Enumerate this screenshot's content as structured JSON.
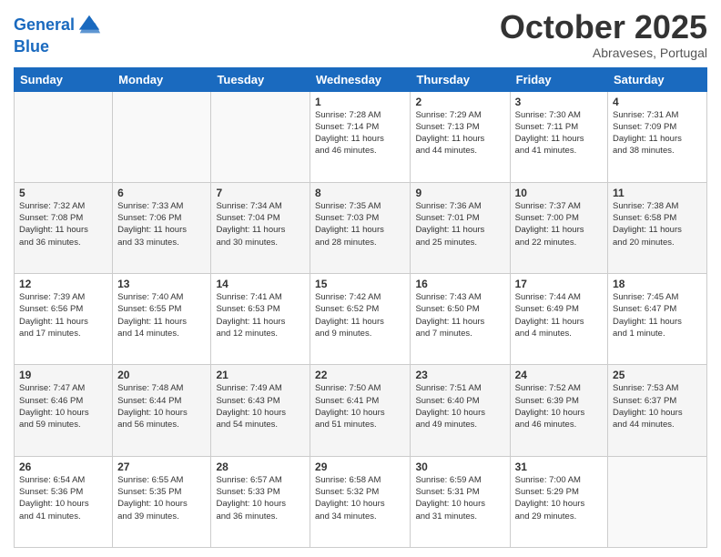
{
  "header": {
    "logo_line1": "General",
    "logo_line2": "Blue",
    "month": "October 2025",
    "location": "Abraveses, Portugal"
  },
  "days_of_week": [
    "Sunday",
    "Monday",
    "Tuesday",
    "Wednesday",
    "Thursday",
    "Friday",
    "Saturday"
  ],
  "weeks": [
    [
      {
        "day": "",
        "info": ""
      },
      {
        "day": "",
        "info": ""
      },
      {
        "day": "",
        "info": ""
      },
      {
        "day": "1",
        "info": "Sunrise: 7:28 AM\nSunset: 7:14 PM\nDaylight: 11 hours\nand 46 minutes."
      },
      {
        "day": "2",
        "info": "Sunrise: 7:29 AM\nSunset: 7:13 PM\nDaylight: 11 hours\nand 44 minutes."
      },
      {
        "day": "3",
        "info": "Sunrise: 7:30 AM\nSunset: 7:11 PM\nDaylight: 11 hours\nand 41 minutes."
      },
      {
        "day": "4",
        "info": "Sunrise: 7:31 AM\nSunset: 7:09 PM\nDaylight: 11 hours\nand 38 minutes."
      }
    ],
    [
      {
        "day": "5",
        "info": "Sunrise: 7:32 AM\nSunset: 7:08 PM\nDaylight: 11 hours\nand 36 minutes."
      },
      {
        "day": "6",
        "info": "Sunrise: 7:33 AM\nSunset: 7:06 PM\nDaylight: 11 hours\nand 33 minutes."
      },
      {
        "day": "7",
        "info": "Sunrise: 7:34 AM\nSunset: 7:04 PM\nDaylight: 11 hours\nand 30 minutes."
      },
      {
        "day": "8",
        "info": "Sunrise: 7:35 AM\nSunset: 7:03 PM\nDaylight: 11 hours\nand 28 minutes."
      },
      {
        "day": "9",
        "info": "Sunrise: 7:36 AM\nSunset: 7:01 PM\nDaylight: 11 hours\nand 25 minutes."
      },
      {
        "day": "10",
        "info": "Sunrise: 7:37 AM\nSunset: 7:00 PM\nDaylight: 11 hours\nand 22 minutes."
      },
      {
        "day": "11",
        "info": "Sunrise: 7:38 AM\nSunset: 6:58 PM\nDaylight: 11 hours\nand 20 minutes."
      }
    ],
    [
      {
        "day": "12",
        "info": "Sunrise: 7:39 AM\nSunset: 6:56 PM\nDaylight: 11 hours\nand 17 minutes."
      },
      {
        "day": "13",
        "info": "Sunrise: 7:40 AM\nSunset: 6:55 PM\nDaylight: 11 hours\nand 14 minutes."
      },
      {
        "day": "14",
        "info": "Sunrise: 7:41 AM\nSunset: 6:53 PM\nDaylight: 11 hours\nand 12 minutes."
      },
      {
        "day": "15",
        "info": "Sunrise: 7:42 AM\nSunset: 6:52 PM\nDaylight: 11 hours\nand 9 minutes."
      },
      {
        "day": "16",
        "info": "Sunrise: 7:43 AM\nSunset: 6:50 PM\nDaylight: 11 hours\nand 7 minutes."
      },
      {
        "day": "17",
        "info": "Sunrise: 7:44 AM\nSunset: 6:49 PM\nDaylight: 11 hours\nand 4 minutes."
      },
      {
        "day": "18",
        "info": "Sunrise: 7:45 AM\nSunset: 6:47 PM\nDaylight: 11 hours\nand 1 minute."
      }
    ],
    [
      {
        "day": "19",
        "info": "Sunrise: 7:47 AM\nSunset: 6:46 PM\nDaylight: 10 hours\nand 59 minutes."
      },
      {
        "day": "20",
        "info": "Sunrise: 7:48 AM\nSunset: 6:44 PM\nDaylight: 10 hours\nand 56 minutes."
      },
      {
        "day": "21",
        "info": "Sunrise: 7:49 AM\nSunset: 6:43 PM\nDaylight: 10 hours\nand 54 minutes."
      },
      {
        "day": "22",
        "info": "Sunrise: 7:50 AM\nSunset: 6:41 PM\nDaylight: 10 hours\nand 51 minutes."
      },
      {
        "day": "23",
        "info": "Sunrise: 7:51 AM\nSunset: 6:40 PM\nDaylight: 10 hours\nand 49 minutes."
      },
      {
        "day": "24",
        "info": "Sunrise: 7:52 AM\nSunset: 6:39 PM\nDaylight: 10 hours\nand 46 minutes."
      },
      {
        "day": "25",
        "info": "Sunrise: 7:53 AM\nSunset: 6:37 PM\nDaylight: 10 hours\nand 44 minutes."
      }
    ],
    [
      {
        "day": "26",
        "info": "Sunrise: 6:54 AM\nSunset: 5:36 PM\nDaylight: 10 hours\nand 41 minutes."
      },
      {
        "day": "27",
        "info": "Sunrise: 6:55 AM\nSunset: 5:35 PM\nDaylight: 10 hours\nand 39 minutes."
      },
      {
        "day": "28",
        "info": "Sunrise: 6:57 AM\nSunset: 5:33 PM\nDaylight: 10 hours\nand 36 minutes."
      },
      {
        "day": "29",
        "info": "Sunrise: 6:58 AM\nSunset: 5:32 PM\nDaylight: 10 hours\nand 34 minutes."
      },
      {
        "day": "30",
        "info": "Sunrise: 6:59 AM\nSunset: 5:31 PM\nDaylight: 10 hours\nand 31 minutes."
      },
      {
        "day": "31",
        "info": "Sunrise: 7:00 AM\nSunset: 5:29 PM\nDaylight: 10 hours\nand 29 minutes."
      },
      {
        "day": "",
        "info": ""
      }
    ]
  ]
}
